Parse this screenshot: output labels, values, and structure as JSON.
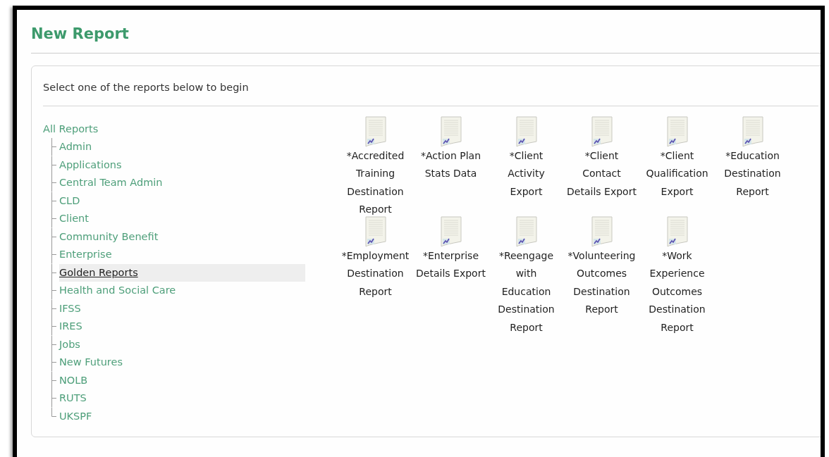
{
  "title": "New Report",
  "instruction": "Select one of the reports below to begin",
  "tree": {
    "label": "All Reports",
    "children": [
      {
        "label": "Admin",
        "selected": false
      },
      {
        "label": "Applications",
        "selected": false
      },
      {
        "label": "Central Team Admin",
        "selected": false
      },
      {
        "label": "CLD",
        "selected": false
      },
      {
        "label": "Client",
        "selected": false
      },
      {
        "label": "Community Benefit",
        "selected": false
      },
      {
        "label": "Enterprise",
        "selected": false
      },
      {
        "label": "Golden Reports",
        "selected": true
      },
      {
        "label": "Health and Social Care",
        "selected": false
      },
      {
        "label": "IFSS",
        "selected": false
      },
      {
        "label": "IRES",
        "selected": false
      },
      {
        "label": "Jobs",
        "selected": false
      },
      {
        "label": "New Futures",
        "selected": false
      },
      {
        "label": "NOLB",
        "selected": false
      },
      {
        "label": "RUTS",
        "selected": false
      },
      {
        "label": "UKSPF",
        "selected": false
      }
    ]
  },
  "reports": [
    {
      "label": "*Accredited Training Destination Report"
    },
    {
      "label": "*Action Plan Stats Data"
    },
    {
      "label": "*Client Activity Export"
    },
    {
      "label": "*Client Contact Details Export"
    },
    {
      "label": "*Client Qualification Export"
    },
    {
      "label": "*Education Destination Report"
    },
    {
      "label": "*Employment Destination Report"
    },
    {
      "label": "*Enterprise Details Export"
    },
    {
      "label": "*Reengage with Education Destination Report"
    },
    {
      "label": "*Volunteering Outcomes Destination Report"
    },
    {
      "label": "*Work Experience Outcomes Destination Report"
    }
  ]
}
